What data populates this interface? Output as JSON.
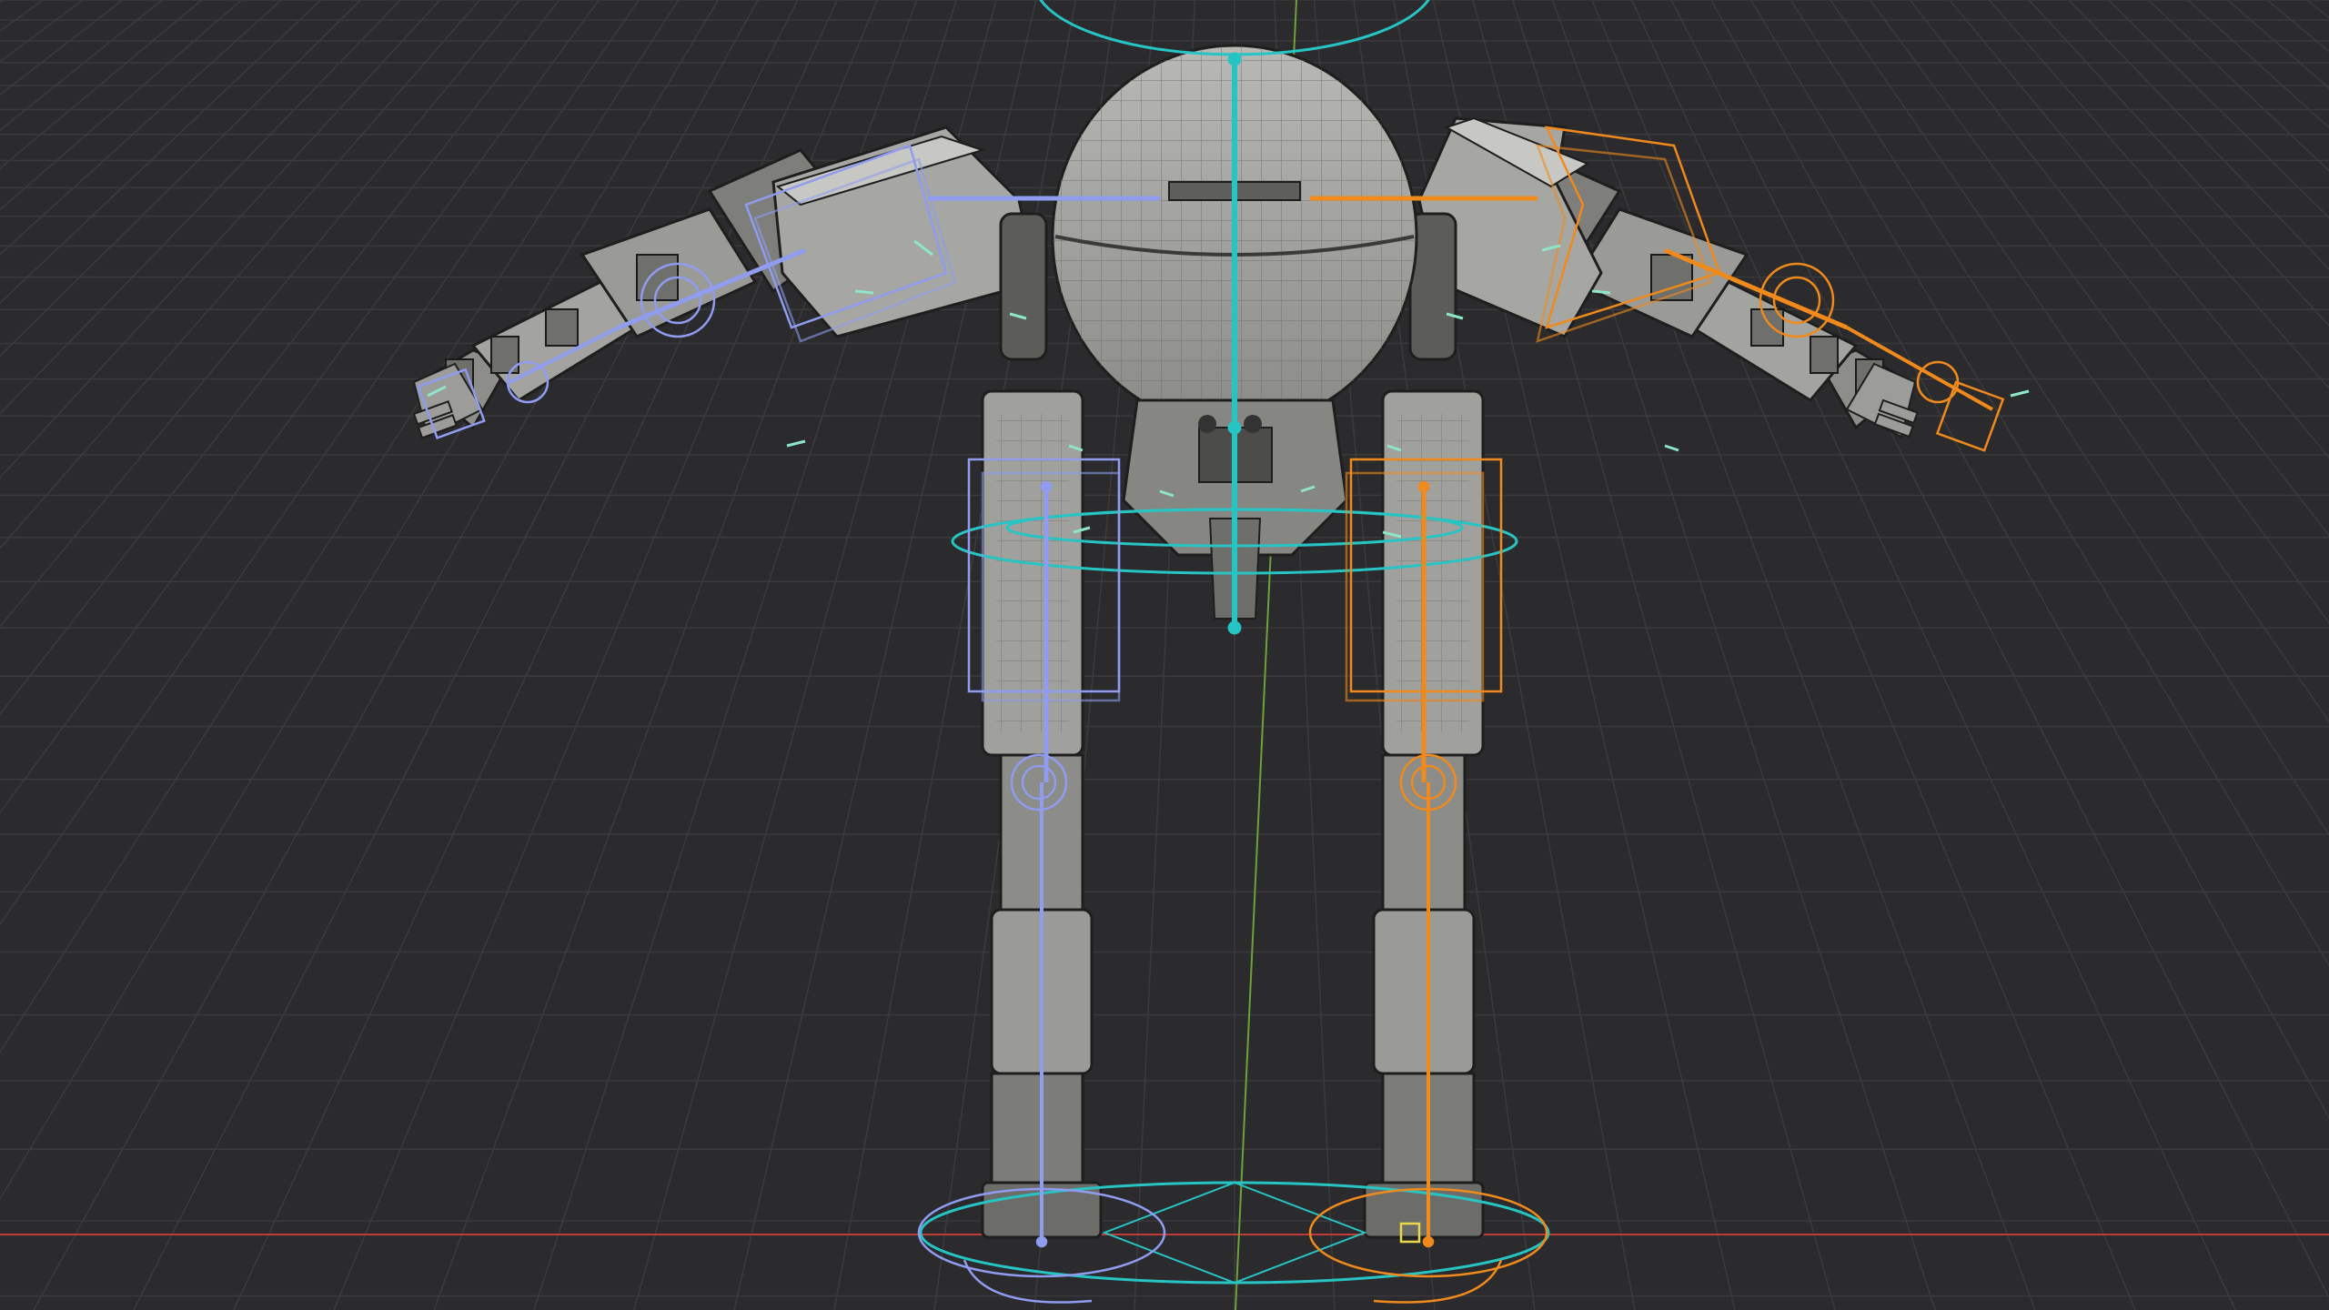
{
  "viewport": {
    "shading": "wireframe-overlay",
    "view": "front-perspective",
    "object": "mech-robot-rig",
    "grid": true,
    "axes": {
      "x_color": "#c23b3b",
      "y_color": "#6da13a"
    }
  },
  "colors": {
    "background": "#2b2b2d",
    "grid": "#3b3b3e",
    "mesh_fill": "#9c9c98",
    "mesh_dark": "#2a2a2a",
    "control_center": "#27c4c4",
    "control_left": "#8f9cf0",
    "control_right": "#f08a1c",
    "bone_tip": "#8ee6c8"
  },
  "rig": {
    "controls": [
      {
        "id": "root-ctrl",
        "side": "center",
        "color": "#27c4c4"
      },
      {
        "id": "hip-ctrl",
        "side": "center",
        "color": "#27c4c4"
      },
      {
        "id": "head-ctrl",
        "side": "center",
        "color": "#27c4c4"
      },
      {
        "id": "arm-ik-left",
        "side": "left",
        "color": "#8f9cf0"
      },
      {
        "id": "leg-ik-left",
        "side": "left",
        "color": "#8f9cf0"
      },
      {
        "id": "arm-ik-right",
        "side": "right",
        "color": "#f08a1c"
      },
      {
        "id": "leg-ik-right",
        "side": "right",
        "color": "#f08a1c"
      }
    ]
  }
}
